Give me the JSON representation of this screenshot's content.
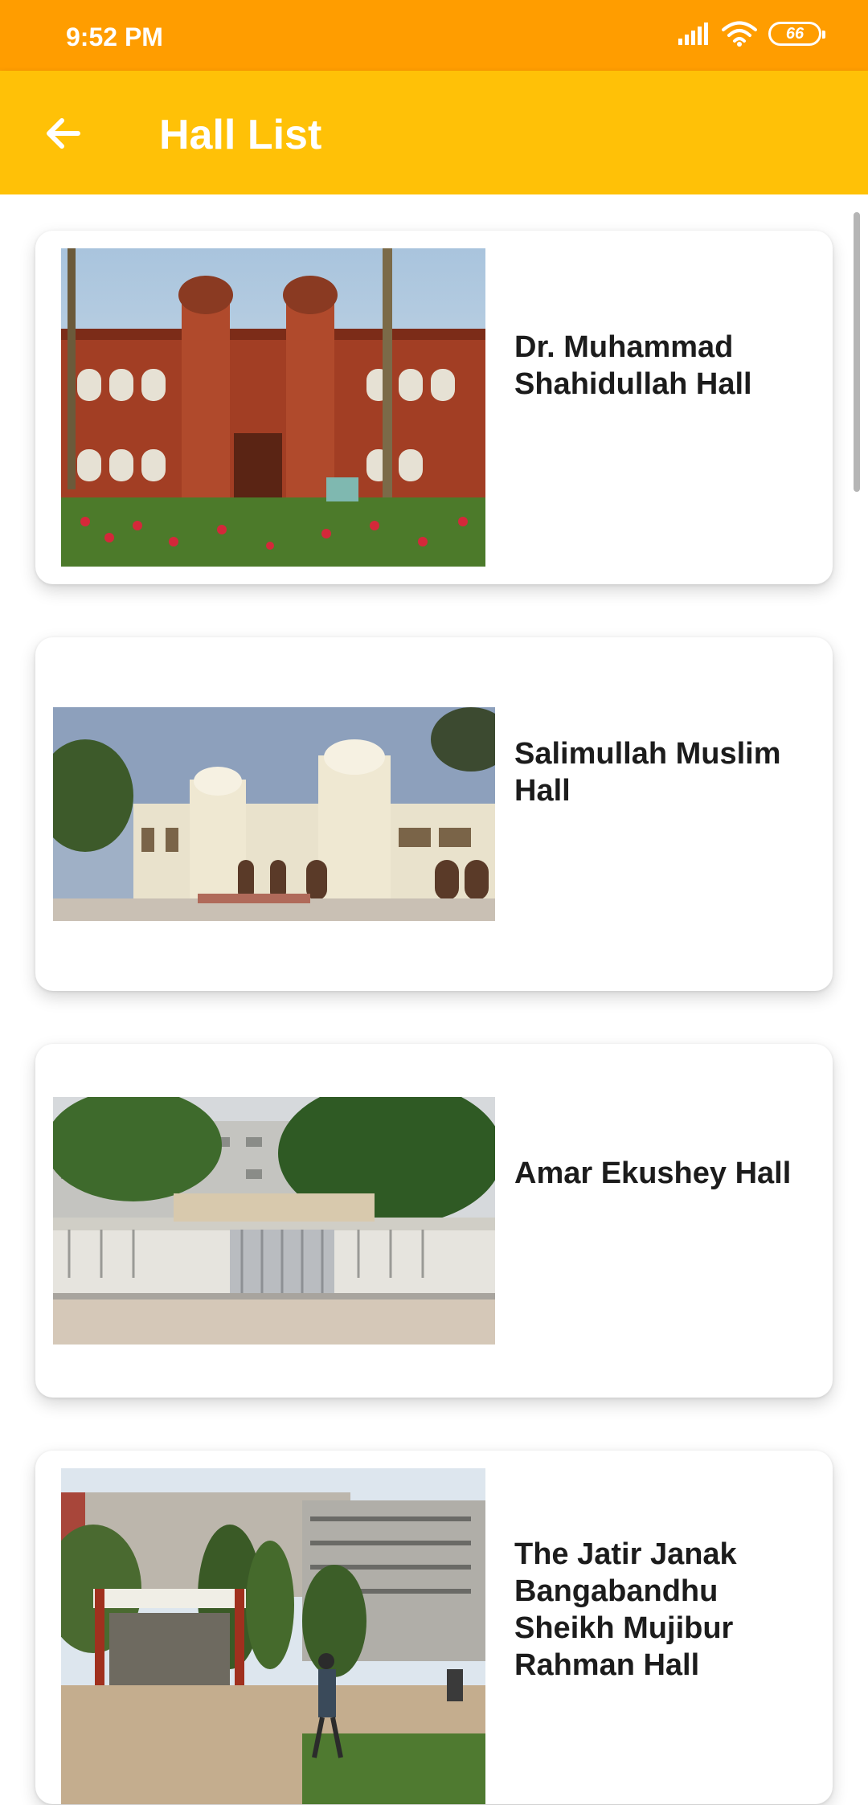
{
  "status_bar": {
    "time": "9:52 PM",
    "battery_level": "66",
    "icons": [
      "signal-icon",
      "wifi-icon",
      "battery-icon"
    ]
  },
  "app_bar": {
    "title": "Hall List",
    "back_icon": "arrow-left-icon"
  },
  "halls": [
    {
      "name": "Dr. Muhammad Shahidullah Hall",
      "photo": "red-brick-building-photo"
    },
    {
      "name": "Salimullah Muslim Hall",
      "photo": "white-domed-building-photo"
    },
    {
      "name": "Amar Ekushey Hall",
      "photo": "gated-building-photo"
    },
    {
      "name": "The Jatir Janak Bangabandhu Sheikh Mujibur Rahman Hall",
      "photo": "campus-building-photo"
    }
  ],
  "colors": {
    "status_bar": "#ff9d00",
    "app_bar": "#ffc107",
    "card_background": "#ffffff",
    "text_primary": "#1c1c1c"
  }
}
